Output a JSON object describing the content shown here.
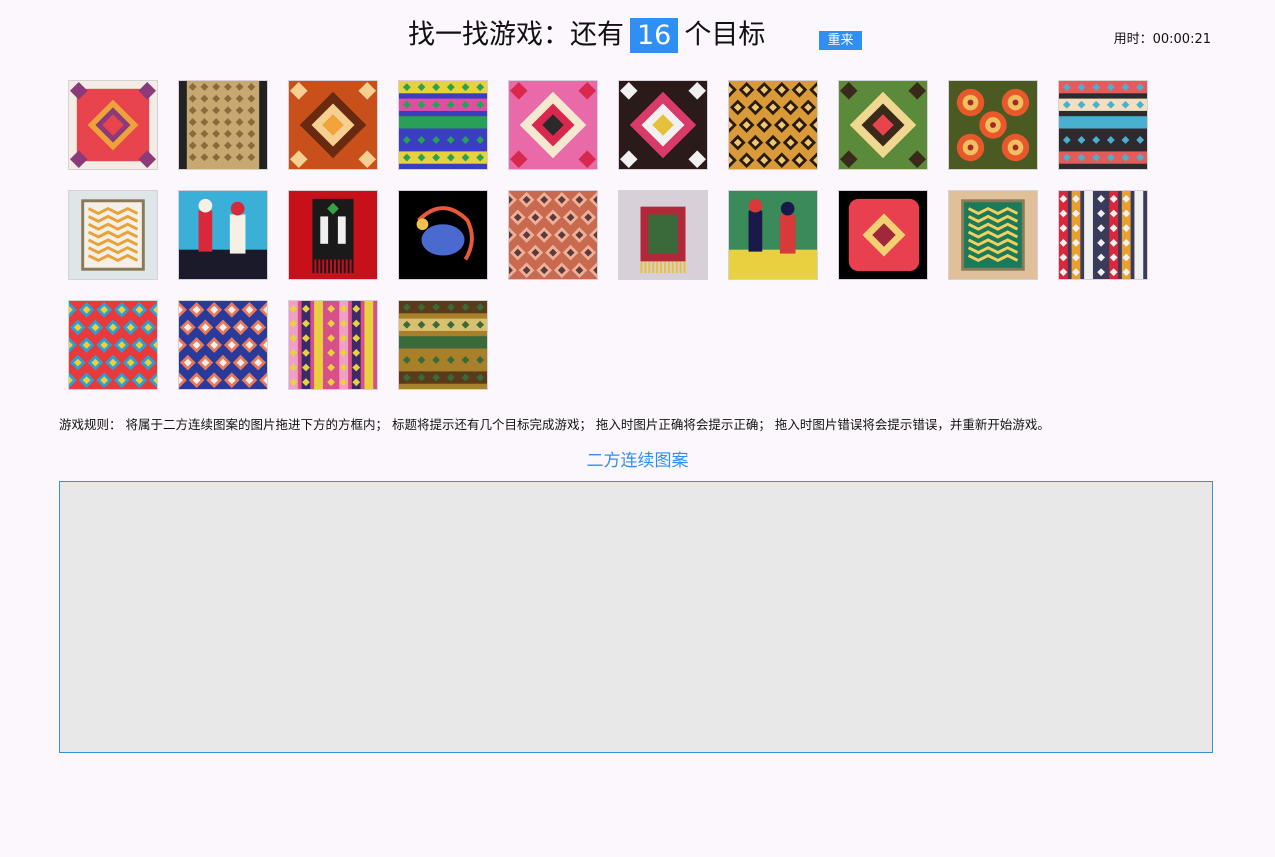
{
  "header": {
    "title_prefix": "找一找游戏：还有",
    "remaining_count": "16",
    "title_suffix": "个目标",
    "reset_label": "重来",
    "timer_label": "用时：",
    "timer_value": "00:00:21"
  },
  "tiles": [
    {
      "c": [
        "#f4ede6",
        "#e8444e",
        "#f0a23a",
        "#8b3a7a"
      ],
      "style": "framed-diamond"
    },
    {
      "c": [
        "#c7a870",
        "#8a6a3a",
        "#5a3b22",
        "#222222"
      ],
      "style": "scroll"
    },
    {
      "c": [
        "#c9501a",
        "#f0a43a",
        "#6a2a10",
        "#f6d090"
      ],
      "style": "diamond"
    },
    {
      "c": [
        "#3a3fc2",
        "#e7d23a",
        "#e04ea0",
        "#28a058"
      ],
      "style": "bands"
    },
    {
      "c": [
        "#e96aa8",
        "#2a2a2a",
        "#f3e9d0",
        "#d8284e"
      ],
      "style": "diamond"
    },
    {
      "c": [
        "#2a1a1a",
        "#e6c03a",
        "#d83a6a",
        "#f1f1f1"
      ],
      "style": "diamond"
    },
    {
      "c": [
        "#d99a3a",
        "#2a1a10",
        "#f0c870",
        "#8a4a1a"
      ],
      "style": "lattice"
    },
    {
      "c": [
        "#5a8a3a",
        "#e8444e",
        "#f0d890",
        "#3a2a1a"
      ],
      "style": "diamond"
    },
    {
      "c": [
        "#4a5a22",
        "#e8582a",
        "#f0c060",
        "#a02a2a"
      ],
      "style": "medallion"
    },
    {
      "c": [
        "#2e2a2e",
        "#e65a5a",
        "#f0e0c0",
        "#4ab0d0"
      ],
      "style": "bands"
    },
    {
      "c": [
        "#dfe6e8",
        "#8a7a5a",
        "#e8a23a",
        "#6a8a3a"
      ],
      "style": "frame"
    },
    {
      "c": [
        "#3ab0d8",
        "#d8283a",
        "#1a1a2a",
        "#f4f0e6"
      ],
      "style": "scene"
    },
    {
      "c": [
        "#c8101a",
        "#1a1a1a",
        "#f0f0f0",
        "#3aa048"
      ],
      "style": "banner"
    },
    {
      "c": [
        "#000000",
        "#e8583a",
        "#4a6ad0",
        "#f0c050"
      ],
      "style": "dragon"
    },
    {
      "c": [
        "#c86a50",
        "#f0b098",
        "#5a3a3a",
        "#e8e0d0"
      ],
      "style": "lattice"
    },
    {
      "c": [
        "#d8d0d8",
        "#b0283a",
        "#e8c03a",
        "#3a6a3a"
      ],
      "style": "bag"
    },
    {
      "c": [
        "#3a8a5a",
        "#1a1a4a",
        "#e8d040",
        "#d83a3a"
      ],
      "style": "scene"
    },
    {
      "c": [
        "#000000",
        "#e8404e",
        "#f0d070",
        "#a0283a"
      ],
      "style": "pillow"
    },
    {
      "c": [
        "#e0c098",
        "#1a7a5a",
        "#e84a3a",
        "#f0d060"
      ],
      "style": "framed"
    },
    {
      "c": [
        "#3a3a5a",
        "#d8283a",
        "#e8a030",
        "#f0f0f0"
      ],
      "style": "stripes"
    },
    {
      "c": [
        "#e83a3a",
        "#28a0d8",
        "#f0d030",
        "#1a2a1a"
      ],
      "style": "lattice"
    },
    {
      "c": [
        "#2a3a9a",
        "#e87a5a",
        "#f0f0f0",
        "#c84a8a"
      ],
      "style": "lattice"
    },
    {
      "c": [
        "#d8508a",
        "#f0a0c8",
        "#3a2a6a",
        "#e8d040"
      ],
      "style": "stripes"
    },
    {
      "c": [
        "#a8802a",
        "#5a3a1a",
        "#d8c070",
        "#3a6a3a"
      ],
      "style": "bands"
    }
  ],
  "rules_text": "游戏规则： 将属于二方连续图案的图片拖进下方的方框内； 标题将提示还有几个目标完成游戏； 拖入时图片正确将会提示正确； 拖入时图片错误将会提示错误，并重新开始游戏。",
  "drop_zone": {
    "title": "二方连续图案"
  }
}
